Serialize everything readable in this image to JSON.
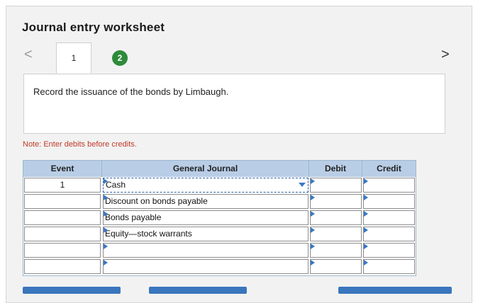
{
  "title": "Journal entry worksheet",
  "nav": {
    "prev": "<",
    "next": ">"
  },
  "tabs": [
    {
      "label": "1"
    },
    {
      "label": "2"
    }
  ],
  "instruction": "Record the issuance of the bonds by Limbaugh.",
  "note": "Note: Enter debits before credits.",
  "table": {
    "headers": {
      "event": "Event",
      "general_journal": "General Journal",
      "debit": "Debit",
      "credit": "Credit"
    },
    "rows": [
      {
        "event": "1",
        "account": "Cash",
        "debit": "",
        "credit": ""
      },
      {
        "event": "",
        "account": "Discount on bonds payable",
        "debit": "",
        "credit": ""
      },
      {
        "event": "",
        "account": "Bonds payable",
        "debit": "",
        "credit": ""
      },
      {
        "event": "",
        "account": "Equity—stock warrants",
        "debit": "",
        "credit": ""
      },
      {
        "event": "",
        "account": "",
        "debit": "",
        "credit": ""
      },
      {
        "event": "",
        "account": "",
        "debit": "",
        "credit": ""
      }
    ]
  },
  "colors": {
    "accent": "#3a76bd",
    "header_bg": "#b9cee6",
    "note_red": "#c0392b",
    "step_green": "#2e8b3a"
  }
}
